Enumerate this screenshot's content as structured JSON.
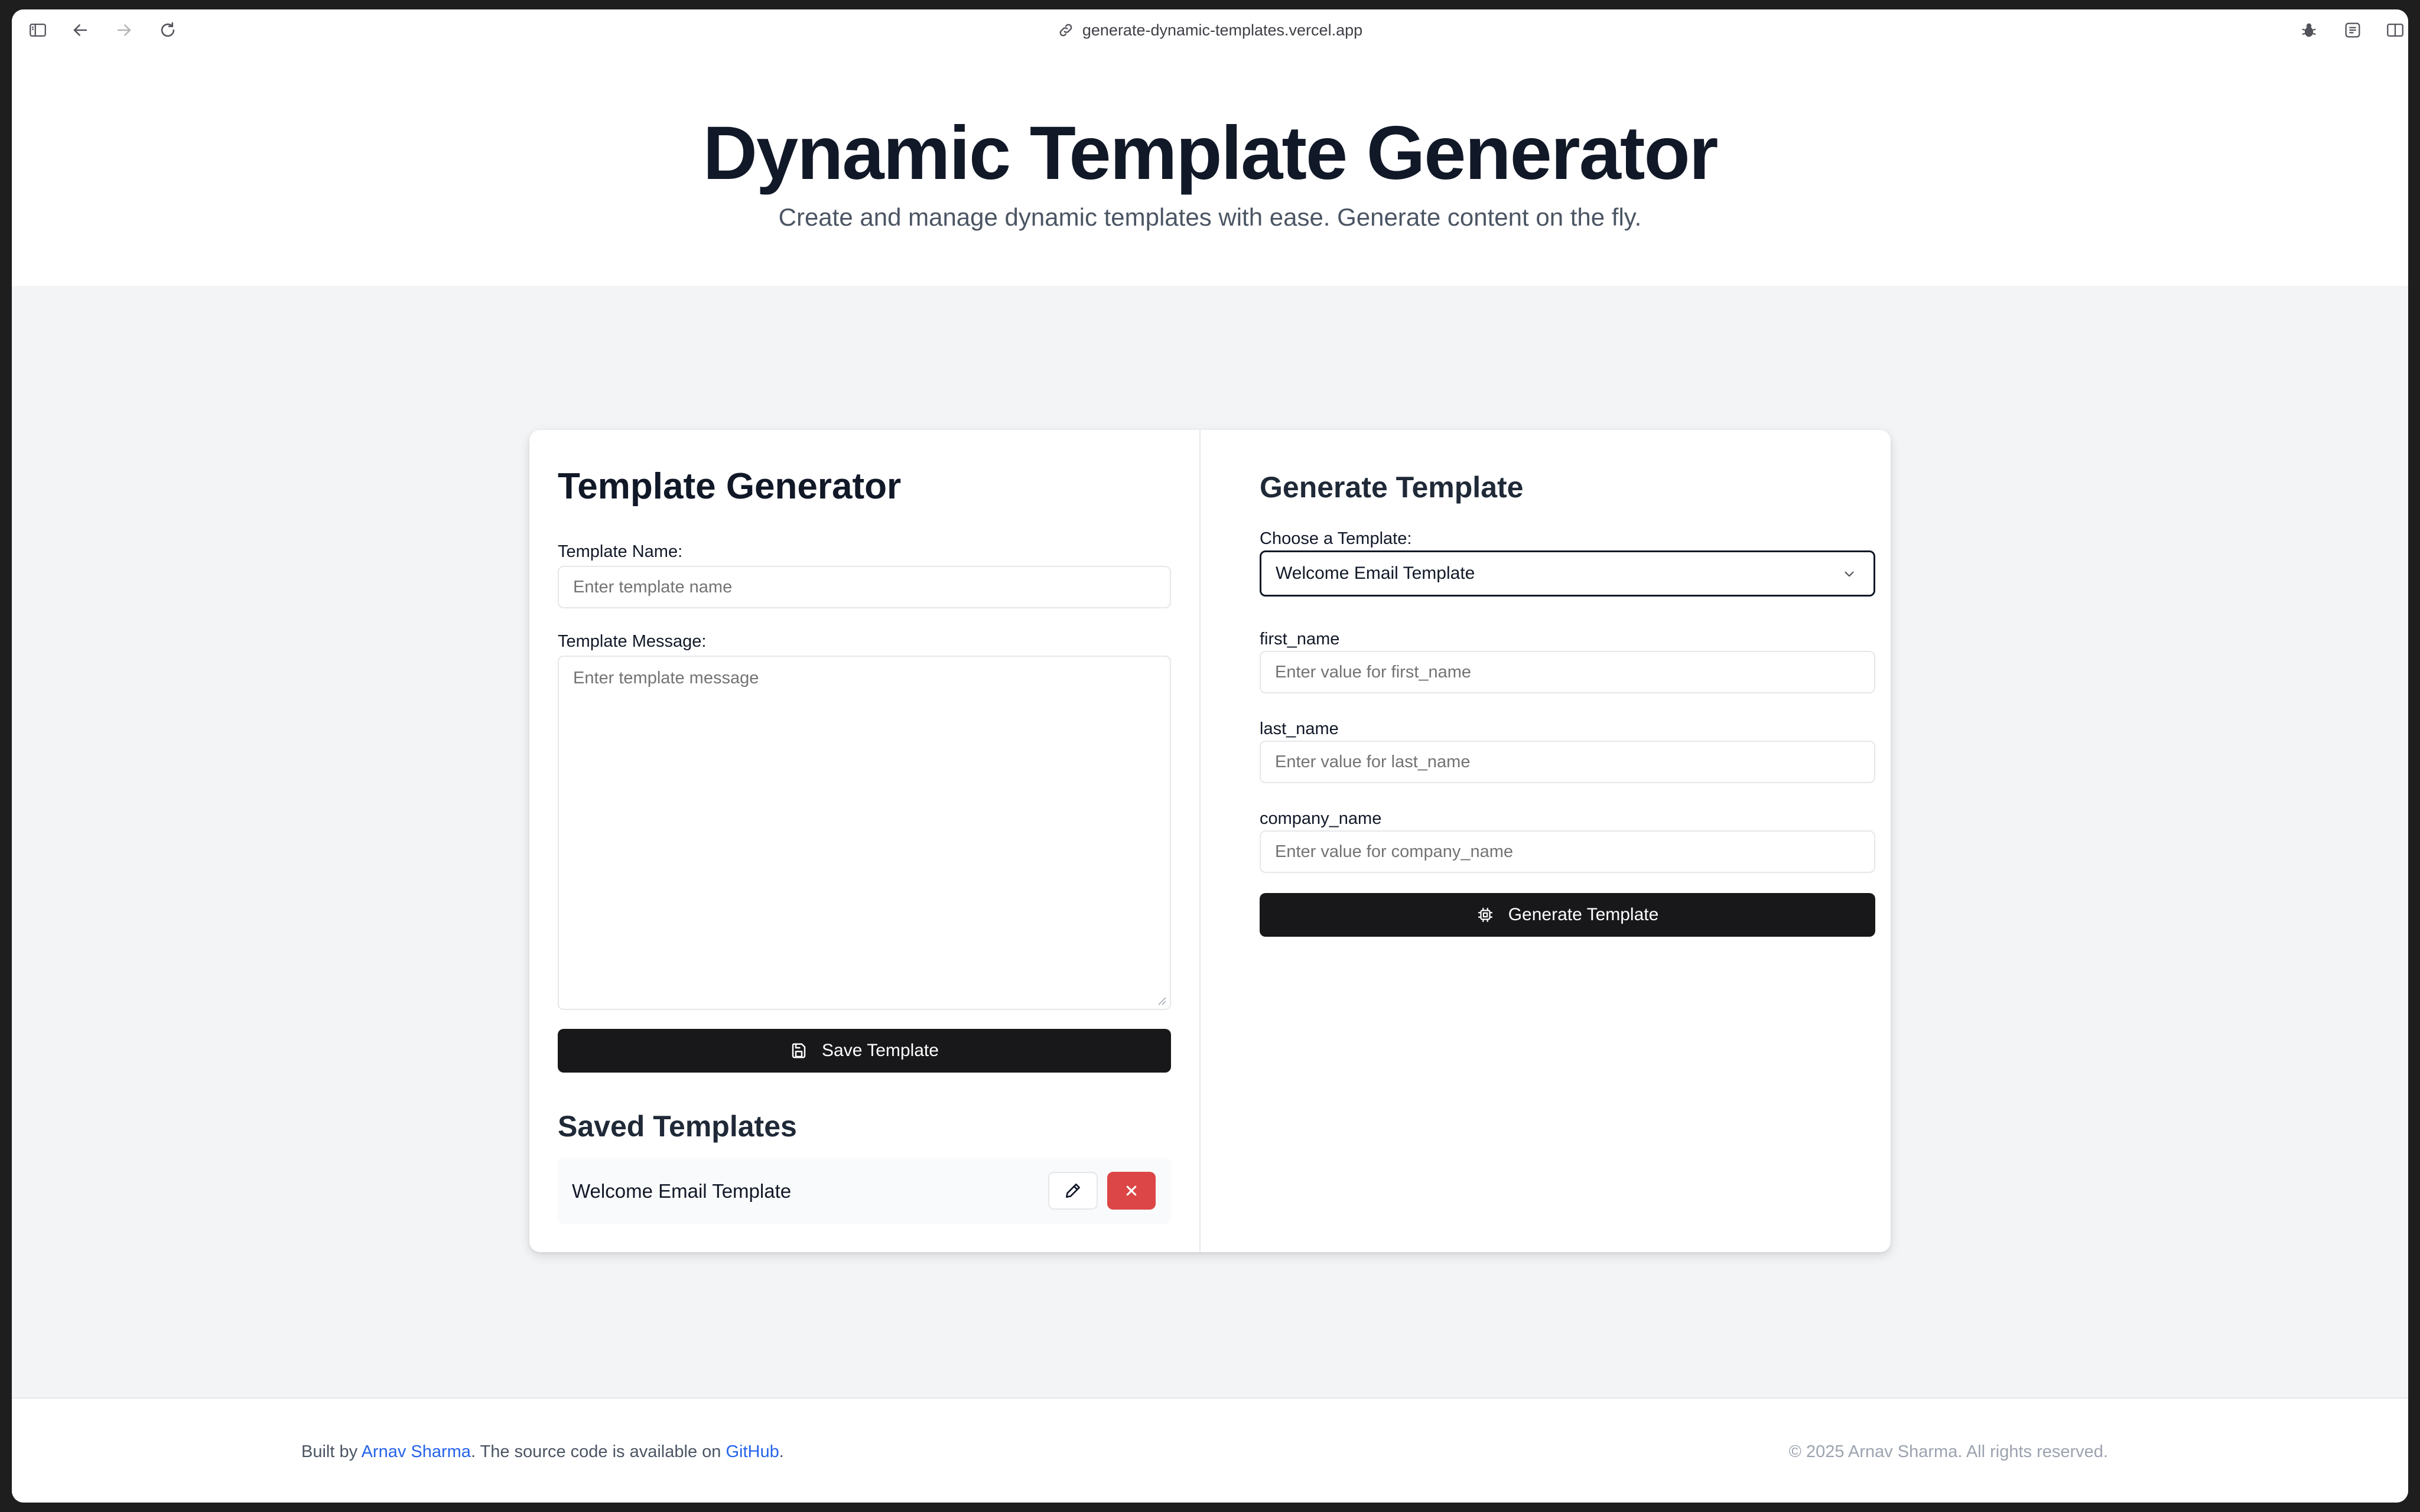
{
  "browser": {
    "url": "generate-dynamic-templates.vercel.app",
    "icons": [
      "sidebar-icon",
      "back-arrow-icon",
      "forward-arrow-icon",
      "reload-icon",
      "link-icon",
      "bug-icon",
      "reader-icon",
      "split-view-icon"
    ]
  },
  "header": {
    "title": "Dynamic Template Generator",
    "subtitle": "Create and manage dynamic templates with ease. Generate content on the fly."
  },
  "generator": {
    "heading": "Template Generator",
    "name_label": "Template Name:",
    "name_placeholder": "Enter template name",
    "name_value": "",
    "message_label": "Template Message:",
    "message_placeholder": "Enter template message",
    "message_value": "",
    "save_button": "Save Template",
    "save_icon": "floppy-disk-icon"
  },
  "saved": {
    "heading": "Saved Templates",
    "items": [
      {
        "name": "Welcome Email Template",
        "edit_icon": "pencil-icon",
        "delete_icon": "x-icon"
      }
    ]
  },
  "generate": {
    "heading": "Generate Template",
    "choose_label": "Choose a Template:",
    "selected": "Welcome Email Template",
    "fields": [
      {
        "label": "first_name",
        "placeholder": "Enter value for first_name",
        "value": ""
      },
      {
        "label": "last_name",
        "placeholder": "Enter value for last_name",
        "value": ""
      },
      {
        "label": "company_name",
        "placeholder": "Enter value for company_name",
        "value": ""
      }
    ],
    "button": "Generate Template",
    "button_icon": "chip-icon"
  },
  "footer": {
    "built_by_prefix": "Built by",
    "author_link": "Arnav Sharma",
    "source_text": ". The source code is available on",
    "github_link": "GitHub",
    "period": ".",
    "copyright": "© 2025 Arnav Sharma. All rights reserved."
  },
  "colors": {
    "primary_button": "#18181b",
    "danger": "#dc4646",
    "link": "#2563eb",
    "page_bg": "#f3f4f6"
  }
}
